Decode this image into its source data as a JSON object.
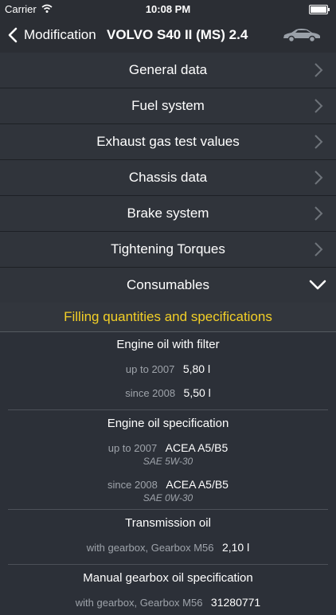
{
  "status": {
    "carrier": "Carrier",
    "time": "10:08 PM"
  },
  "nav": {
    "back_label": "Modification",
    "title": "VOLVO S40 II (MS) 2.4"
  },
  "menu": [
    {
      "label": "General data"
    },
    {
      "label": "Fuel system"
    },
    {
      "label": "Exhaust gas test values"
    },
    {
      "label": "Chassis data"
    },
    {
      "label": "Brake system"
    },
    {
      "label": "Tightening Torques"
    },
    {
      "label": "Consumables"
    }
  ],
  "section": {
    "title": "Filling quantities and specifications"
  },
  "groups": {
    "engine_oil": {
      "title": "Engine oil with filter",
      "rows": [
        {
          "cond": "up to 2007",
          "value": "5,80 l"
        },
        {
          "cond": "since 2008",
          "value": "5,50 l"
        }
      ]
    },
    "oil_spec": {
      "title": "Engine oil specification",
      "rows": [
        {
          "cond": "up to 2007",
          "value": "ACEA A5/B5",
          "note": "SAE 5W-30"
        },
        {
          "cond": "since 2008",
          "value": "ACEA A5/B5",
          "note": "SAE 0W-30"
        }
      ]
    },
    "transmission": {
      "title": "Transmission oil",
      "rows": [
        {
          "cond": "with gearbox, Gearbox M56",
          "value": "2,10 l"
        }
      ]
    },
    "gearbox_spec": {
      "title": "Manual gearbox oil specification",
      "rows": [
        {
          "cond": "with gearbox, Gearbox M56",
          "value": "31280771"
        }
      ]
    }
  }
}
